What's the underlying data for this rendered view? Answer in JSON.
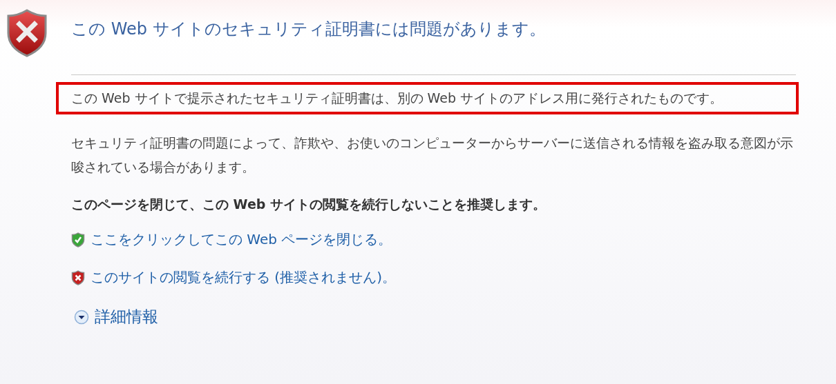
{
  "title": "この Web サイトのセキュリティ証明書には問題があります。",
  "paragraphs": [
    {
      "text": "この Web サイトで提示されたセキュリティ証明書は、別の Web サイトのアドレス用に発行されたものです。",
      "highlighted": true
    },
    {
      "text": "セキュリティ証明書の問題によって、詐欺や、お使いのコンピューターからサーバーに送信される情報を盗み取る意図が示唆されている場合があります。",
      "highlighted": false
    }
  ],
  "recommendation": "このページを閉じて、この Web サイトの閲覧を続行しないことを推奨します。",
  "links": [
    {
      "kind": "safe",
      "label": "ここをクリックしてこの Web ページを閉じる。"
    },
    {
      "kind": "unsafe",
      "label": "このサイトの閲覧を続行する (推奨されません)。"
    }
  ],
  "more_info": {
    "label": "詳細情報",
    "expanded": false
  }
}
